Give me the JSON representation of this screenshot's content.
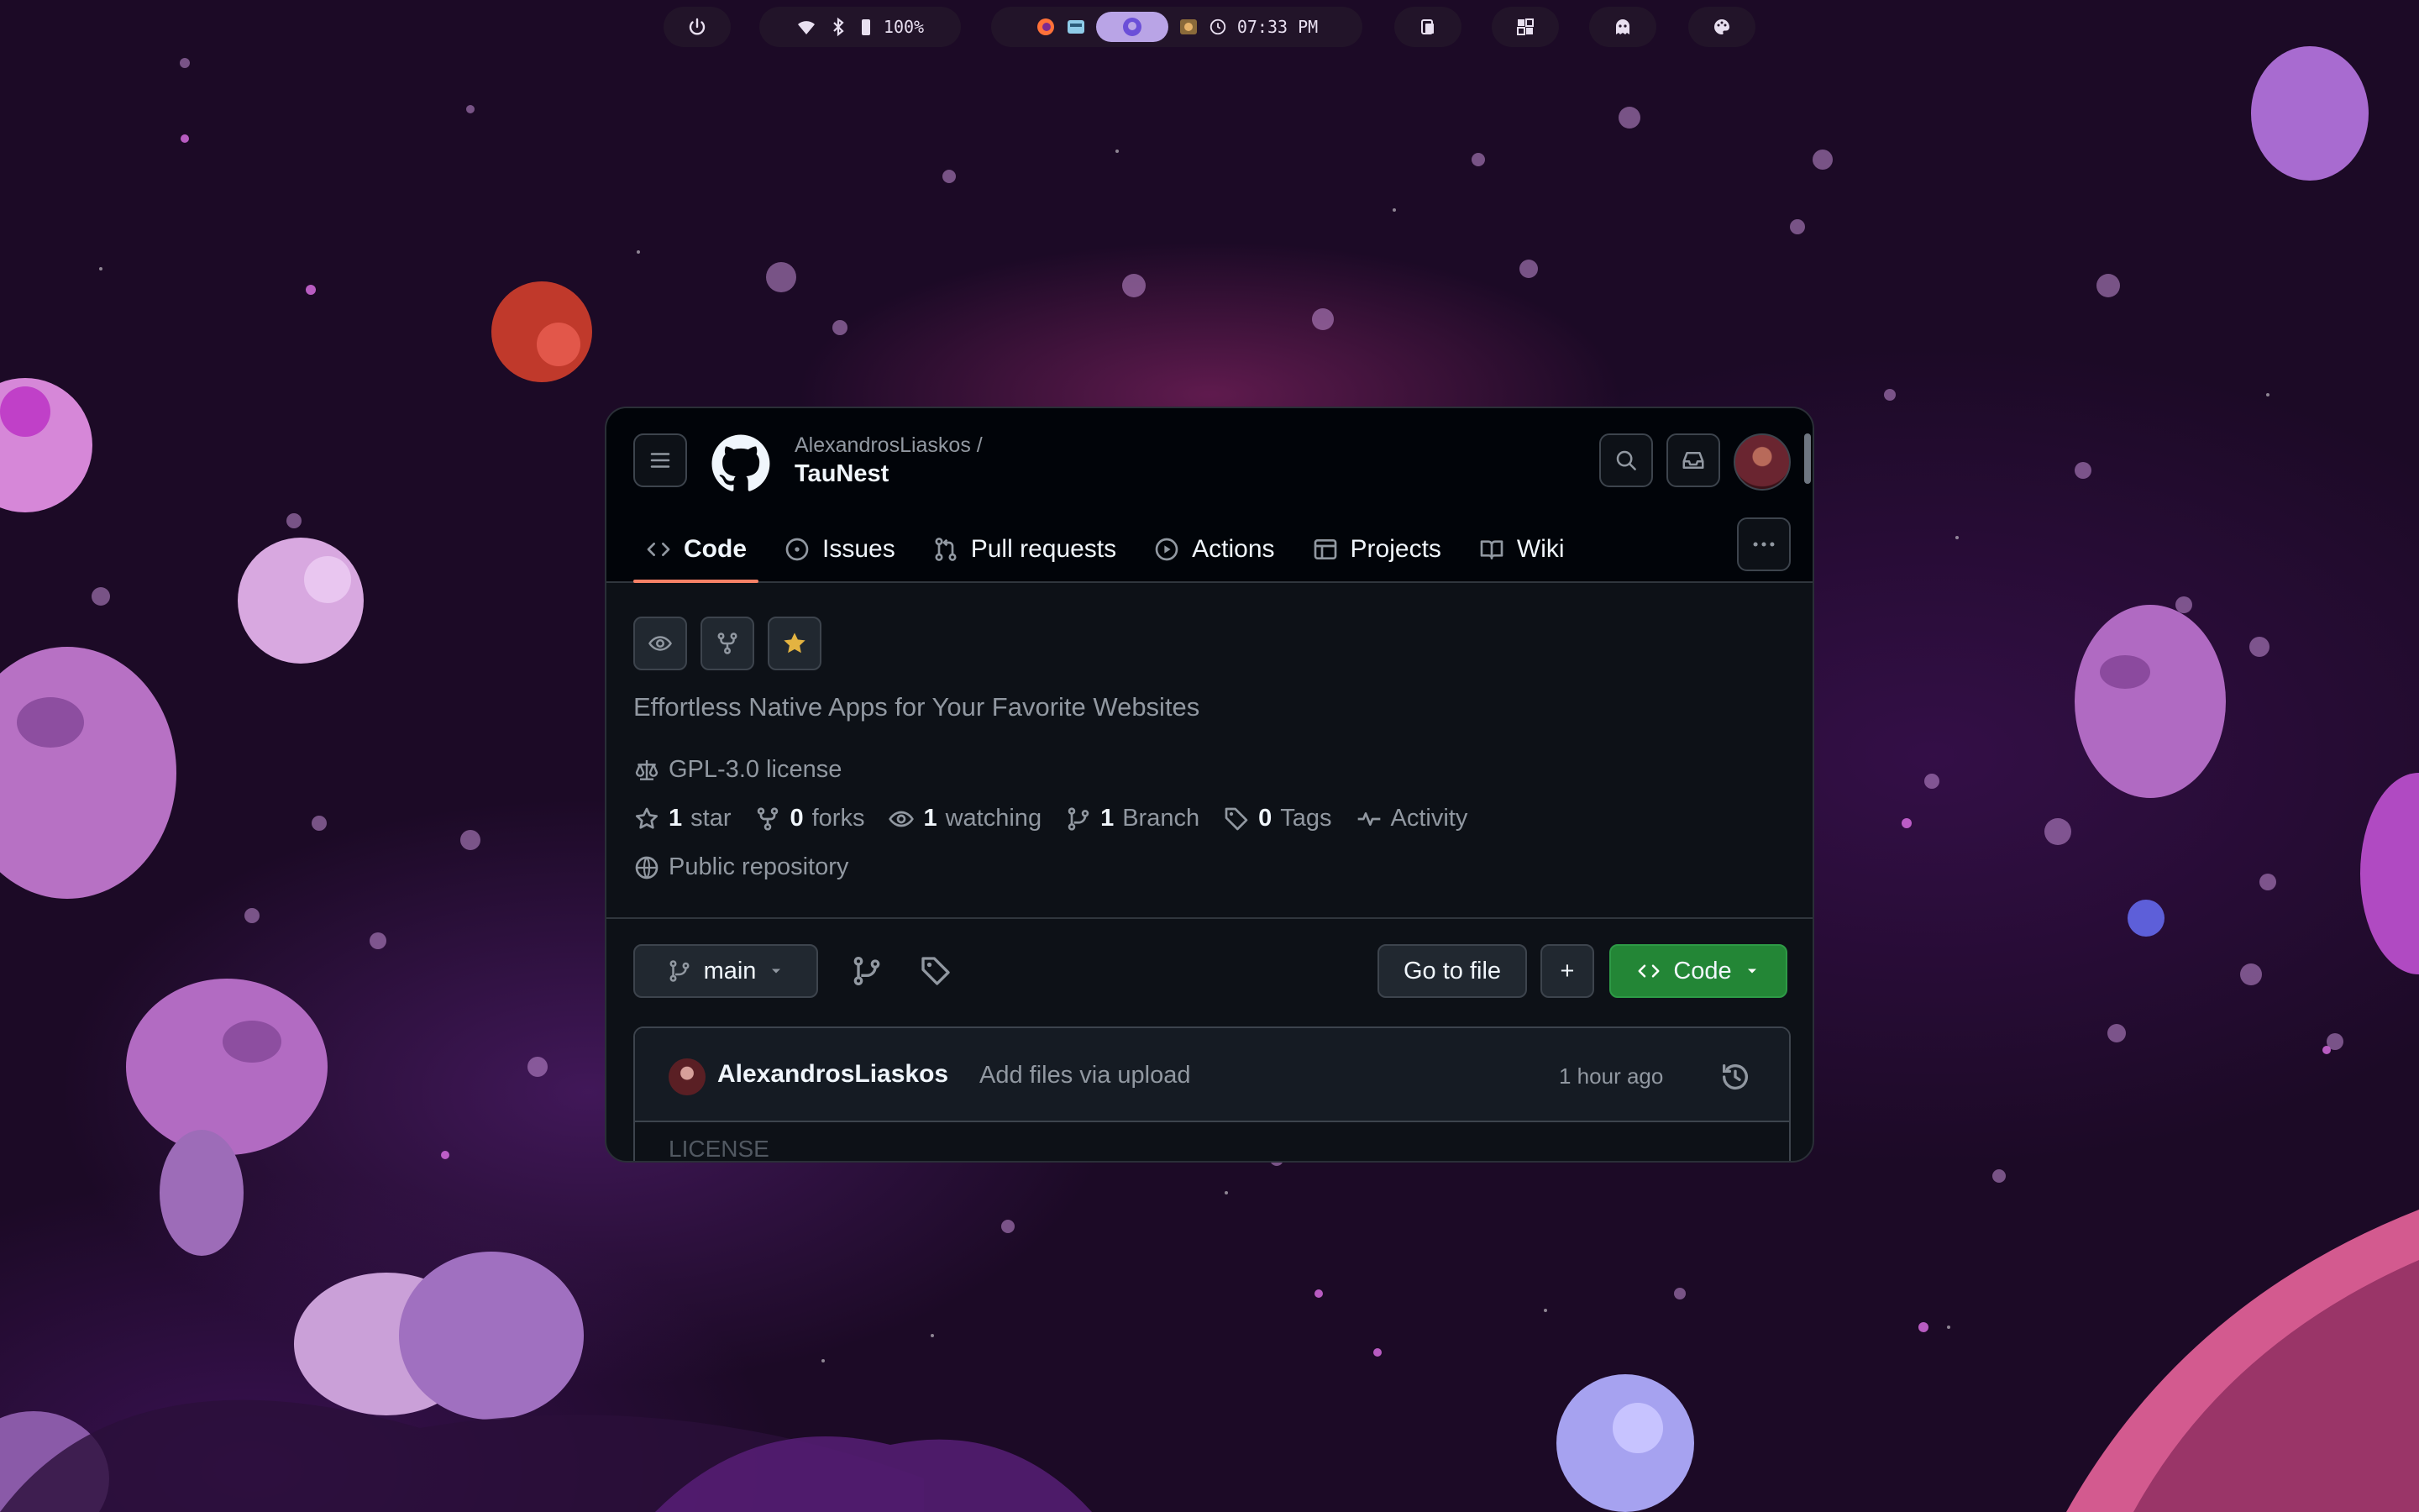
{
  "topbar": {
    "battery": "100%",
    "clock": "07:33 PM"
  },
  "window": {
    "owner": "AlexandrosLiaskos /",
    "repo_name": "TauNest",
    "tabs": [
      {
        "label": "Code",
        "icon": "code-icon"
      },
      {
        "label": "Issues",
        "icon": "issue-icon"
      },
      {
        "label": "Pull requests",
        "icon": "pull-request-icon"
      },
      {
        "label": "Actions",
        "icon": "play-icon"
      },
      {
        "label": "Projects",
        "icon": "table-icon"
      },
      {
        "label": "Wiki",
        "icon": "book-icon"
      }
    ],
    "description": "Effortless Native Apps for Your Favorite Websites",
    "license": "GPL-3.0 license",
    "stats": {
      "stars_count": "1",
      "stars_label": "star",
      "forks_count": "0",
      "forks_label": "forks",
      "watching_count": "1",
      "watching_label": "watching",
      "branch_count": "1",
      "branch_label": "Branch",
      "tags_count": "0",
      "tags_label": "Tags",
      "activity_label": "Activity"
    },
    "visibility": "Public repository",
    "branch_selector": "main",
    "go_to_file": "Go to file",
    "add_file": "+",
    "code_button": "Code",
    "latest_commit": {
      "author": "AlexandrosLiaskos",
      "message": "Add files via upload",
      "time": "1 hour ago"
    },
    "first_file_ghost": "LICENSE"
  },
  "colors": {
    "accent_underline": "#f78166",
    "green_button": "#238636",
    "star_color": "#e3b341"
  }
}
